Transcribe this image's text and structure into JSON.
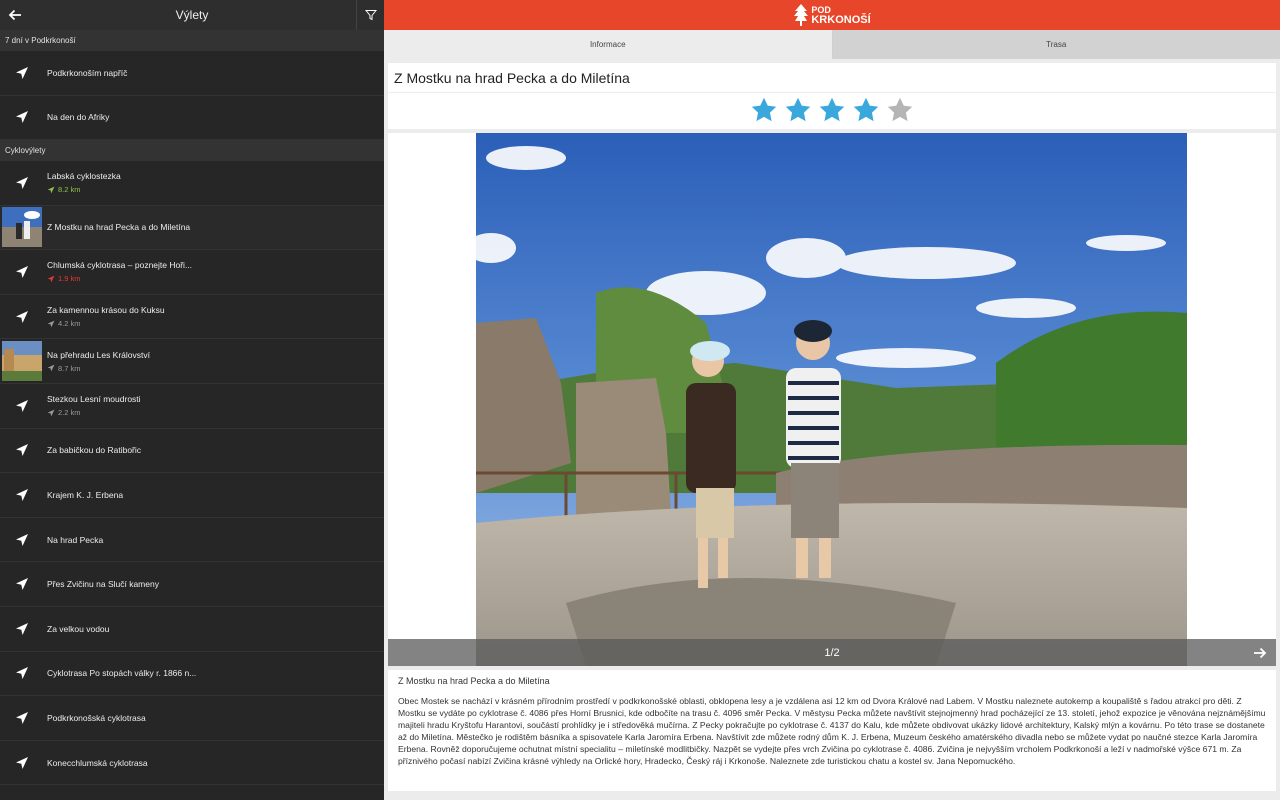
{
  "left_panel": {
    "title": "Výlety",
    "sections": [
      {
        "header": "7 dní v Podkrkonoší",
        "items": [
          {
            "name": "Podkrkonoším napříč",
            "distance": "",
            "thumbnail": ""
          },
          {
            "name": "Na den do Afriky",
            "distance": "",
            "thumbnail": ""
          }
        ]
      },
      {
        "header": "Cyklovýlety",
        "items": [
          {
            "name": "Labská cyklostezka",
            "distance": "8.2 km",
            "distance_color": "#8bc34a",
            "thumbnail": ""
          },
          {
            "name": "Z Mostku na hrad Pecka a do Miletína",
            "distance": "",
            "thumbnail": "pecka"
          },
          {
            "name": "Chlumská cyklotrasa – poznejte Hoři...",
            "distance": "1.9 km",
            "distance_color": "#e53935",
            "thumbnail": ""
          },
          {
            "name": "Za kamennou krásou do Kuksu",
            "distance": "4.2 km",
            "distance_color": "#9a9a9a",
            "thumbnail": ""
          },
          {
            "name": "Na přehradu Les Království",
            "distance": "8.7 km",
            "distance_color": "#9a9a9a",
            "thumbnail": "dam"
          },
          {
            "name": "Stezkou Lesní moudrosti",
            "distance": "2.2 km",
            "distance_color": "#9a9a9a",
            "thumbnail": ""
          },
          {
            "name": "Za babičkou do Ratibořic",
            "distance": "",
            "thumbnail": ""
          },
          {
            "name": "Krajem K. J. Erbena",
            "distance": "",
            "thumbnail": ""
          },
          {
            "name": "Na hrad Pecka",
            "distance": "",
            "thumbnail": ""
          },
          {
            "name": "Přes Zvičinu na Slučí kameny",
            "distance": "",
            "thumbnail": ""
          },
          {
            "name": "Za velkou vodou",
            "distance": "",
            "thumbnail": ""
          },
          {
            "name": "Cyklotrasa Po stopách války r. 1866 n...",
            "distance": "",
            "thumbnail": ""
          },
          {
            "name": "Podkrkonošská cyklotrasa",
            "distance": "",
            "thumbnail": ""
          },
          {
            "name": "Konecchlumská cyklotrasa",
            "distance": "",
            "thumbnail": ""
          }
        ]
      }
    ]
  },
  "brand": {
    "logo_line1": "POD",
    "logo_line2": "KRKONOŠÍ",
    "color": "#e8462a"
  },
  "tabs": [
    {
      "label": "Informace",
      "active": true
    },
    {
      "label": "Trasa",
      "active": false
    }
  ],
  "detail": {
    "title": "Z Mostku na hrad Pecka a do Miletína",
    "rating": 4,
    "rating_max": 5,
    "gallery_counter": "1/2",
    "caption": "Z Mostku na hrad Pecka a do Miletína",
    "description": "Obec Mostek se nachází v krásném přírodním prostředí v podkrkonošské oblasti, obklopena lesy a je vzdálena asi 12 km od Dvora Králové nad Labem. V Mostku naleznete autokemp a koupaliště s řadou atrakcí pro děti. Z Mostku se vydáte po cyklotrase č. 4086 přes Horní Brusnici, kde odbočíte na trasu č. 4096 směr Pecka. V městysu Pecka můžete navštívit stejnojmenný hrad pocházející ze 13. století, jehož expozice je věnována nejznámějšímu majiteli hradu Kryštofu Harantovi, součástí prohlídky je i středověká mučírna. Z Pecky pokračujte po cyklotrase č. 4137 do Kalu, kde můžete obdivovat ukázky lidové architektury, Kalský mlýn a kovárnu. Po této trase se dostanete až do Miletína. Městečko je rodištěm básníka a spisovatele Karla Jaromíra Erbena. Navštívit zde můžete rodný dům K. J. Erbena, Muzeum českého amatérského divadla nebo se můžete vydat po naučné stezce Karla Jaromíra Erbena. Rovněž doporučujeme ochutnat místní specialitu – miletínské modlitbičky. Nazpět se vydejte přes vrch Zvičina po cyklotrase č. 4086. Zvičina je nejvyšším vrcholem Podkrkonoší a leží v nadmořské výšce 671 m. Za příznivého počasí nabízí Zvičina krásné výhledy na Orlické hory, Hradecko, Český ráj i Krkonoše. Naleznete zde turistickou chatu a kostel sv. Jana Nepomuckého."
  },
  "colors": {
    "star_on": "#3aa8dc",
    "star_off": "#b5b5b5"
  }
}
